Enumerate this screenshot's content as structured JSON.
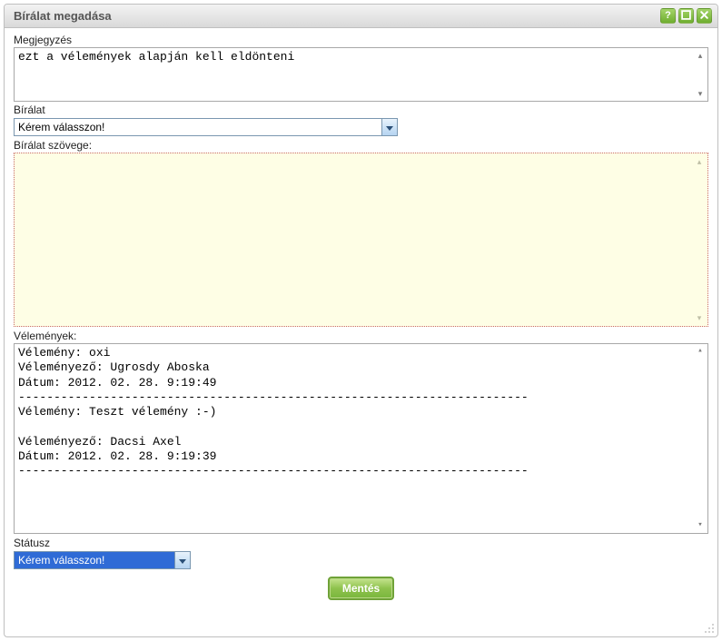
{
  "window": {
    "title": "Bírálat megadása"
  },
  "labels": {
    "megjegyzes": "Megjegyzés",
    "biralat": "Bírálat",
    "biralat_szovege": "Bírálat szövege:",
    "velemenyek": "Vélemények:",
    "statusz": "Státusz"
  },
  "fields": {
    "megjegyzes_value": "ezt a vélemények alapján kell eldönteni",
    "biralat_select_value": "Kérem válasszon!",
    "biralat_szoveg_value": "",
    "status_select_value": "Kérem válasszon!"
  },
  "velemenyek_text": "Vélemény: oxi\nVéleményező: Ugrosdy Aboska\nDátum: 2012. 02. 28. 9:19:49\n------------------------------------------------------------------------\nVélemény: Teszt vélemény :-)\n\nVéleményező: Dacsi Axel\nDátum: 2012. 02. 28. 9:19:39\n------------------------------------------------------------------------",
  "buttons": {
    "save": "Mentés"
  }
}
